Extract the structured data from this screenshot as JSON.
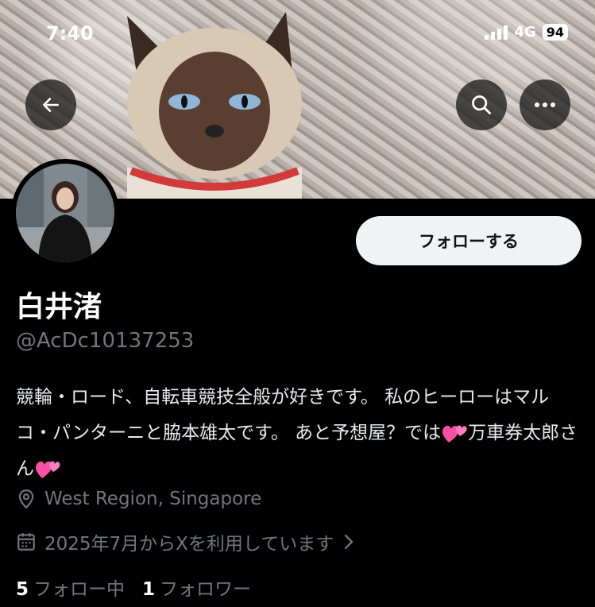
{
  "status_bar": {
    "time": "7:40",
    "network": "4G",
    "battery": "94"
  },
  "header": {
    "back_icon": "arrow-left-icon",
    "search_icon": "search-icon",
    "more_icon": "more-dots-icon"
  },
  "profile": {
    "follow_label": "フォローする",
    "display_name": "白井渚",
    "handle": "@AcDc10137253",
    "bio_part1": "競輪・ロード、自転車競技全般が好きです。 私のヒーローはマルコ・パンターニと脇本雄太です。 あと予想屋？では",
    "bio_part2": "万車券太郎さん",
    "bio_emoji": "two-hearts-emoji",
    "location": "West Region, Singapore",
    "joined": "2025年7月からXを利用しています",
    "following_count": "5",
    "following_label": "フォロー中",
    "followers_count": "1",
    "followers_label": "フォロワー"
  },
  "colors": {
    "background": "#000000",
    "text_primary": "#e7e9ea",
    "text_secondary": "#71767b",
    "follow_button_bg": "#eff3f4"
  }
}
